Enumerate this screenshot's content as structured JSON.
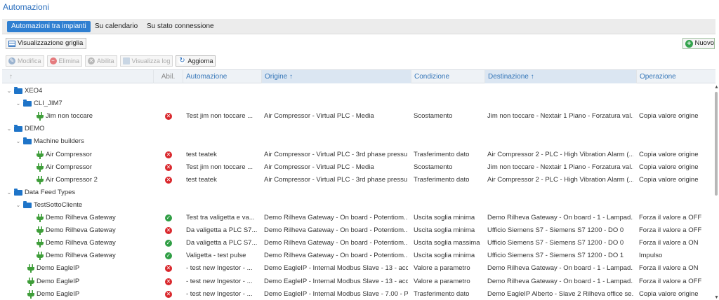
{
  "page": {
    "title": "Automazioni"
  },
  "tabs": [
    {
      "label": "Automazioni tra impianti",
      "active": true
    },
    {
      "label": "Su calendario",
      "active": false
    },
    {
      "label": "Su stato connessione",
      "active": false
    }
  ],
  "view_button": {
    "label": "Visualizzazione griglia",
    "icon": "grid-view-icon"
  },
  "new_button": {
    "label": "Nuovo",
    "icon": "plus-circle-icon"
  },
  "toolbar": {
    "modifica": "Modifica",
    "elimina": "Elimina",
    "abilita": "Abilita",
    "visualizza_log": "Visualizza log",
    "aggiorna": "Aggiorna"
  },
  "columns": {
    "sort": "↑",
    "abil": "Abil.",
    "automazione": "Automazione",
    "origine": "Origine ↑",
    "condizione": "Condizione",
    "destinazione": "Destinazione ↑",
    "operazione": "Operazione"
  },
  "rows": [
    {
      "type": "group",
      "level": 0,
      "label": "XEO4"
    },
    {
      "type": "group",
      "level": 1,
      "label": "CLI_JIM7"
    },
    {
      "type": "item",
      "level": 2,
      "label": "Jim non toccare",
      "enabled": false,
      "automazione": "Test jim non toccare ...",
      "origine": "Air Compressor - Virtual PLC - Media",
      "condizione": "Scostamento",
      "destinazione": "Jim non toccare - Nextair 1 Piano - Forzatura val...",
      "operazione": "Copia valore origine"
    },
    {
      "type": "group",
      "level": 0,
      "label": "DEMO"
    },
    {
      "type": "group",
      "level": 1,
      "label": "Machine builders"
    },
    {
      "type": "item",
      "level": 2,
      "label": "Air Compressor",
      "enabled": false,
      "automazione": "test teatek",
      "origine": "Air Compressor - Virtual PLC - 3rd phase pressu...",
      "condizione": "Trasferimento dato",
      "destinazione": "Air Compressor 2 - PLC - High Vibration Alarm (...",
      "operazione": "Copia valore origine"
    },
    {
      "type": "item",
      "level": 2,
      "label": "Air Compressor",
      "enabled": false,
      "automazione": "Test jim non toccare ...",
      "origine": "Air Compressor - Virtual PLC - Media",
      "condizione": "Scostamento",
      "destinazione": "Jim non toccare - Nextair 1 Piano - Forzatura val...",
      "operazione": "Copia valore origine"
    },
    {
      "type": "item",
      "level": 2,
      "label": "Air Compressor 2",
      "enabled": false,
      "automazione": "test teatek",
      "origine": "Air Compressor - Virtual PLC - 3rd phase pressu...",
      "condizione": "Trasferimento dato",
      "destinazione": "Air Compressor 2 - PLC - High Vibration Alarm (...",
      "operazione": "Copia valore origine"
    },
    {
      "type": "group",
      "level": 0,
      "label": "Data Feed Types"
    },
    {
      "type": "group",
      "level": 1,
      "label": "TestSottoCliente"
    },
    {
      "type": "item",
      "level": 2,
      "label": "Demo Rilheva Gateway",
      "enabled": true,
      "automazione": "Test tra valigetta e va...",
      "origine": "Demo Rilheva Gateway - On board - Potentiom...",
      "condizione": "Uscita soglia minima",
      "destinazione": "Demo Rilheva Gateway - On board - 1 - Lampad...",
      "operazione": "Forza il valore a OFF"
    },
    {
      "type": "item",
      "level": 2,
      "label": "Demo Rilheva Gateway",
      "enabled": false,
      "automazione": "Da valigetta a PLC S7...",
      "origine": "Demo Rilheva Gateway - On board - Potentiom...",
      "condizione": "Uscita soglia minima",
      "destinazione": "Ufficio Siemens S7 - Siemens S7 1200 - DO 0",
      "operazione": "Forza il valore a OFF"
    },
    {
      "type": "item",
      "level": 2,
      "label": "Demo Rilheva Gateway",
      "enabled": true,
      "automazione": "Da valigetta a PLC S7...",
      "origine": "Demo Rilheva Gateway - On board - Potentiom...",
      "condizione": "Uscita soglia massima",
      "destinazione": "Ufficio Siemens S7 - Siemens S7 1200 - DO 0",
      "operazione": "Forza il valore a ON"
    },
    {
      "type": "item",
      "level": 2,
      "label": "Demo Rilheva Gateway",
      "enabled": true,
      "automazione": "Valigetta - test pulse",
      "origine": "Demo Rilheva Gateway - On board - Potentiom...",
      "condizione": "Uscita soglia minima",
      "destinazione": "Ufficio Siemens S7 - Siemens S7 1200 - DO 1",
      "operazione": "Impulso"
    },
    {
      "type": "item",
      "level": 1,
      "label": "Demo EagleIP",
      "enabled": false,
      "automazione": "- test new Ingestor - ...",
      "origine": "Demo EagleIP - Internal Modbus Slave - 13 - acc...",
      "condizione": "Valore a parametro",
      "destinazione": "Demo Rilheva Gateway - On board - 1 - Lampad...",
      "operazione": "Forza il valore a ON"
    },
    {
      "type": "item",
      "level": 1,
      "label": "Demo EagleIP",
      "enabled": false,
      "automazione": "- test new Ingestor - ...",
      "origine": "Demo EagleIP - Internal Modbus Slave - 13 - acc...",
      "condizione": "Valore a parametro",
      "destinazione": "Demo Rilheva Gateway - On board - 1 - Lampad...",
      "operazione": "Forza il valore a OFF"
    },
    {
      "type": "item",
      "level": 1,
      "label": "Demo EagleIP",
      "enabled": false,
      "automazione": "- test new Ingestor - ...",
      "origine": "Demo EagleIP - Internal Modbus Slave - 7.00 - P...",
      "condizione": "Trasferimento dato",
      "destinazione": "Demo EagleIP Alberto - Slave 2 Rilheva office se...",
      "operazione": "Copia valore origine"
    }
  ],
  "colors": {
    "accent": "#2f7fd1",
    "status_on": "#2f9e44",
    "status_off": "#d9262b",
    "folder": "#1e74c8",
    "plug": "#3f9e3a"
  }
}
